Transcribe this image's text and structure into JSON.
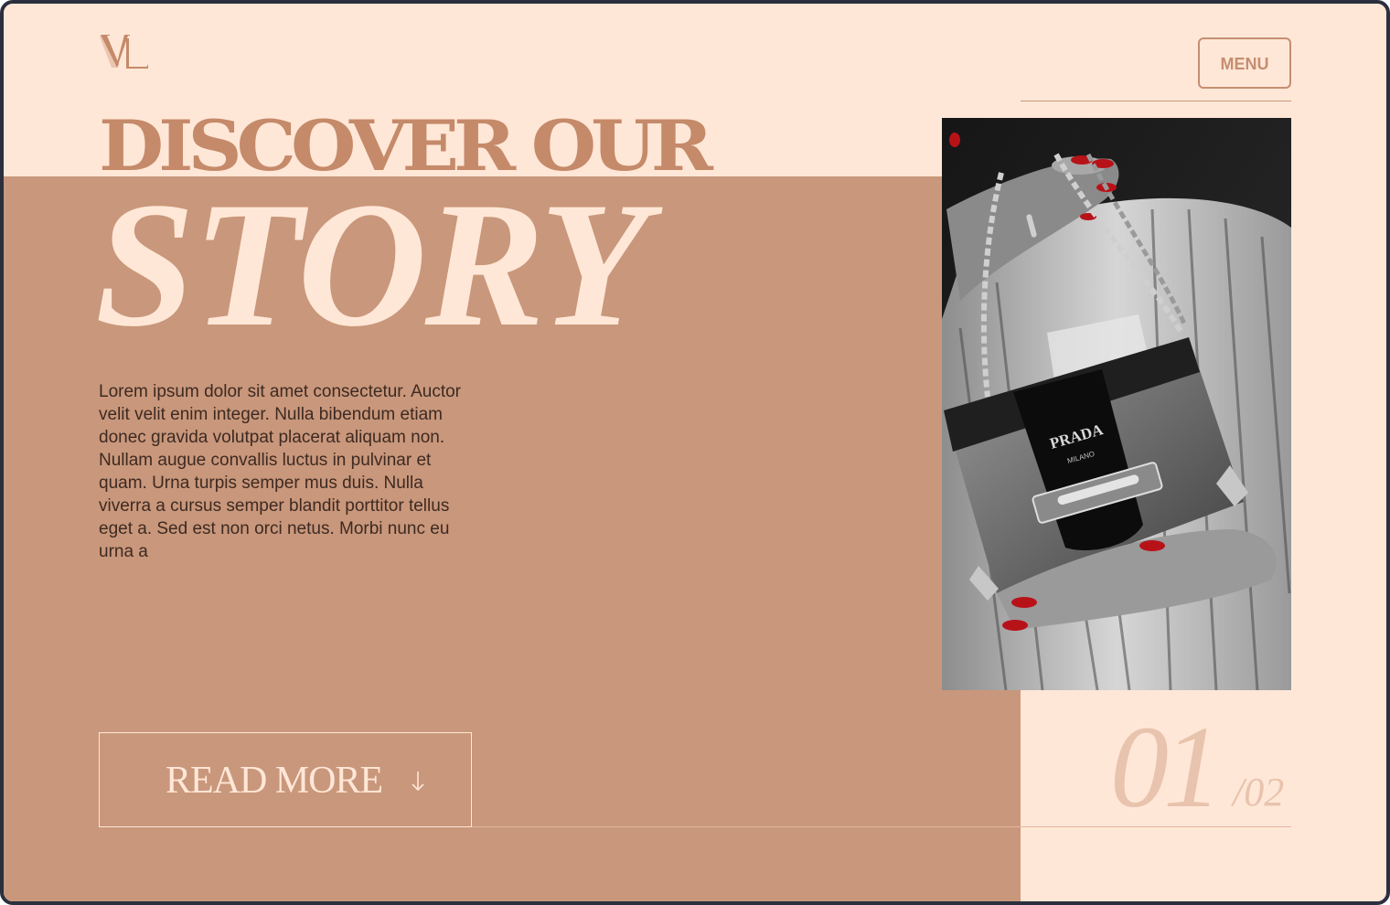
{
  "brand": {
    "logo_text": "VL",
    "accent_color": "#c58a6a",
    "panel_color": "#c9977b",
    "background_color": "#ffe7d7"
  },
  "header": {
    "menu_label": "MENU"
  },
  "hero": {
    "headline_top": "DISCOVER OUR",
    "headline_bottom": "STORY",
    "body": "Lorem ipsum dolor sit amet consectetur. Auctor velit velit enim integer. Nulla bibendum etiam donec gravida volutpat placerat aliquam non. Nullam augue convallis luctus in pulvinar et quam. Urna turpis semper mus duis. Nulla viverra a cursus semper blandit porttitor tellus eget a. Sed est non orci netus. Morbi nunc eu urna a",
    "cta_label": "READ MORE",
    "cta_icon": "arrow-down-icon"
  },
  "photo": {
    "bag_brand": "PRADA",
    "bag_sub": "MILANO"
  },
  "pagination": {
    "current": "01",
    "total": "/02"
  }
}
